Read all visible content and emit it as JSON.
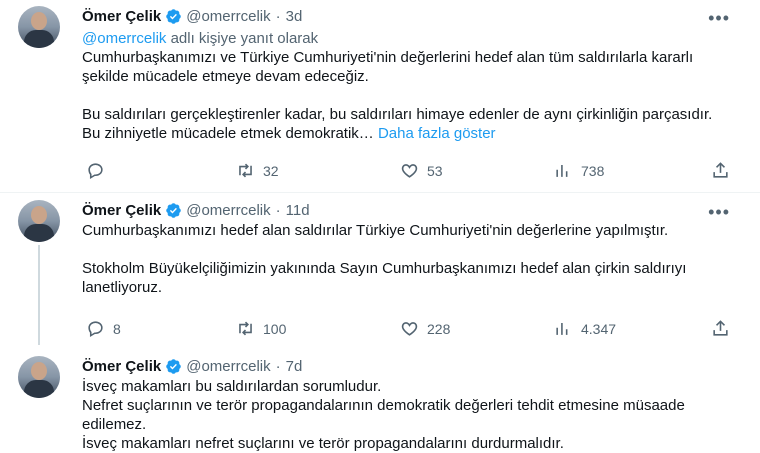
{
  "tweets": [
    {
      "author": {
        "name": "Ömer Çelik",
        "handle": "@omerrcelik",
        "time": "3d"
      },
      "reply_prefix": "@omerrcelik",
      "reply_suffix": " adlı kişiye yanıt olarak",
      "paragraphs": [
        "Cumhurbaşkanımızı ve Türkiye Cumhuriyeti'nin değerlerini hedef alan tüm saldırılarla kararlı şekilde mücadele etmeye devam edeceğiz.",
        "Bu saldırıları gerçekleştirenler kadar, bu saldırıları himaye edenler de aynı çirkinliğin parçasıdır. Bu zihniyetle mücadele etmek demokratik…"
      ],
      "show_more": "Daha fazla göster",
      "stats": {
        "replies": "",
        "retweets": "32",
        "likes": "53",
        "views": "738"
      }
    },
    {
      "author": {
        "name": "Ömer Çelik",
        "handle": "@omerrcelik",
        "time": "11d"
      },
      "paragraphs": [
        "Cumhurbaşkanımızı hedef alan saldırılar Türkiye Cumhuriyeti'nin değerlerine yapılmıştır.",
        "Stokholm Büyükelçiliğimizin yakınında Sayın Cumhurbaşkanımızı hedef alan çirkin saldırıyı lanetliyoruz."
      ],
      "stats": {
        "replies": "8",
        "retweets": "100",
        "likes": "228",
        "views": "4.347"
      }
    },
    {
      "author": {
        "name": "Ömer Çelik",
        "handle": "@omerrcelik",
        "time": "7d"
      },
      "lines": [
        "İsveç makamları bu saldırılardan sorumludur.",
        "Nefret suçlarının ve terör propagandalarının demokratik değerleri tehdit etmesine müsaade edilemez.",
        "İsveç makamları nefret suçlarını ve terör propagandalarını durdurmalıdır."
      ]
    }
  ],
  "ui": {
    "more_glyph": "•••",
    "accent": "#1d9bf0",
    "muted": "#536471"
  }
}
